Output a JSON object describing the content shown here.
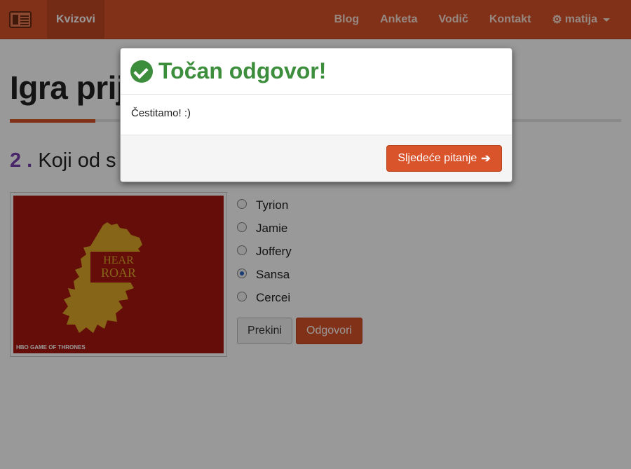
{
  "navbar": {
    "brand_icon": "newspaper-icon",
    "active_item": "Kvizovi",
    "links": [
      "Blog",
      "Anketa",
      "Vodič",
      "Kontakt"
    ],
    "user": "matija",
    "user_icon": "gear-icon",
    "colors": {
      "bar": "#d9532b",
      "active": "#c04825"
    }
  },
  "page": {
    "title": "Igra prij",
    "question_number": "2 .",
    "question_text": "Koji od s"
  },
  "quiz": {
    "answers": [
      {
        "label": "Tyrion",
        "checked": false
      },
      {
        "label": "Jamie",
        "checked": false
      },
      {
        "label": "Joffery",
        "checked": false
      },
      {
        "label": "Sansa",
        "checked": true
      },
      {
        "label": "Cercei",
        "checked": false
      }
    ],
    "cancel_label": "Prekini",
    "submit_label": "Odgovori"
  },
  "modal": {
    "title": "Točan odgovor!",
    "body": "Čestitamo! :)",
    "next_label": "Sljedeće pitanje",
    "title_color": "#3c8d3c"
  }
}
